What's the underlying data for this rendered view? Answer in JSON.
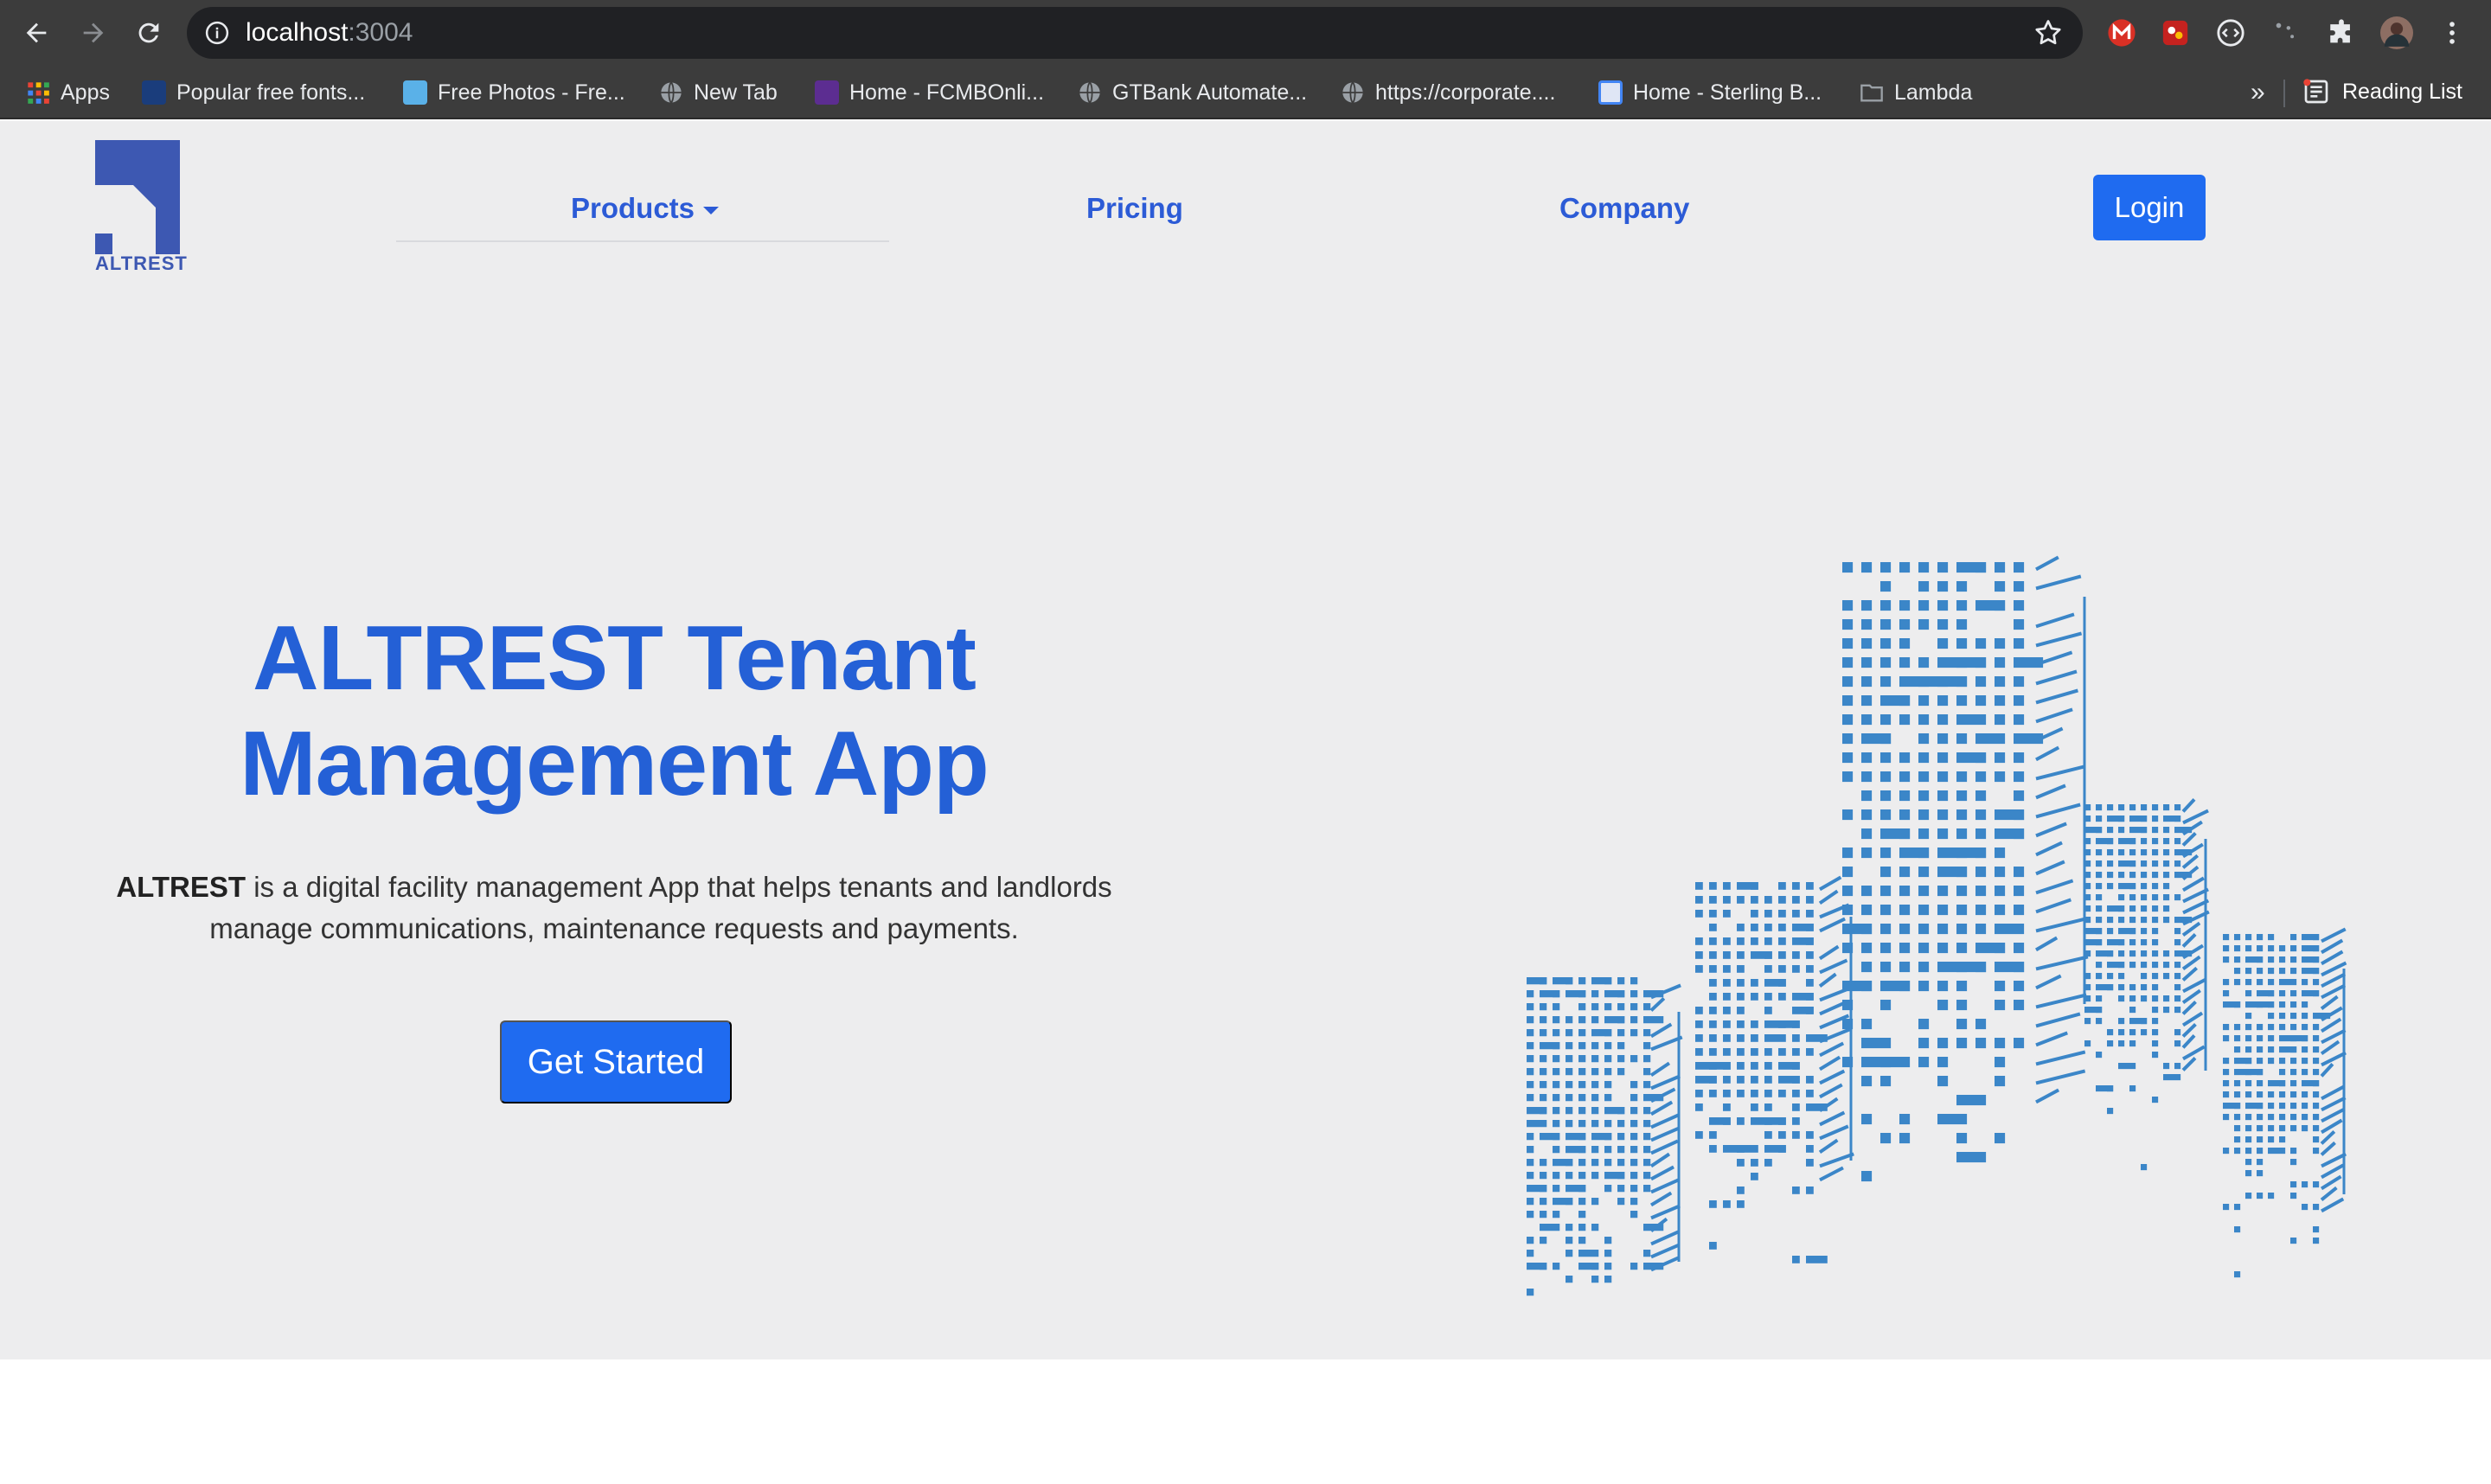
{
  "browser": {
    "url_host": "localhost",
    "url_port": ":3004",
    "bookmarks": [
      {
        "label": "Apps",
        "icon": "apps-grid-icon",
        "color": "#ea4335"
      },
      {
        "label": "Popular free fonts...",
        "icon": "fonts-site-icon",
        "color": "#1a73e8"
      },
      {
        "label": "Free Photos - Fre...",
        "icon": "photos-site-icon",
        "color": "#34a853"
      },
      {
        "label": "New Tab",
        "icon": "globe-icon",
        "color": "#9aa0a6"
      },
      {
        "label": "Home - FCMBOnli...",
        "icon": "fcmb-site-icon",
        "color": "#5c2d91"
      },
      {
        "label": "GTBank Automate...",
        "icon": "globe-icon",
        "color": "#9aa0a6"
      },
      {
        "label": "https://corporate....",
        "icon": "globe-icon",
        "color": "#9aa0a6"
      },
      {
        "label": "Home - Sterling B...",
        "icon": "sterling-site-icon",
        "color": "#4285f4"
      },
      {
        "label": "Lambda",
        "icon": "folder-icon",
        "color": "#9aa0a6"
      }
    ],
    "more_label": "»",
    "reading_list_label": "Reading List"
  },
  "site": {
    "logo_text": "ALTREST",
    "nav": {
      "products": "Products",
      "pricing": "Pricing",
      "company": "Company",
      "login": "Login"
    },
    "hero": {
      "title_line1": "ALTREST Tenant",
      "title_line2": "Management App",
      "desc_brand": "ALTREST",
      "desc_line1": " is a digital facility management App that helps tenants and landlords",
      "desc_line2": "manage communications, maintenance requests and payments.",
      "cta": "Get Started"
    }
  },
  "colors": {
    "brand_blue": "#2460d6",
    "button_blue": "#1f6bf0",
    "logo_blue": "#3d58b2",
    "city_blue": "#3b86c8",
    "page_bg": "#ededee"
  }
}
